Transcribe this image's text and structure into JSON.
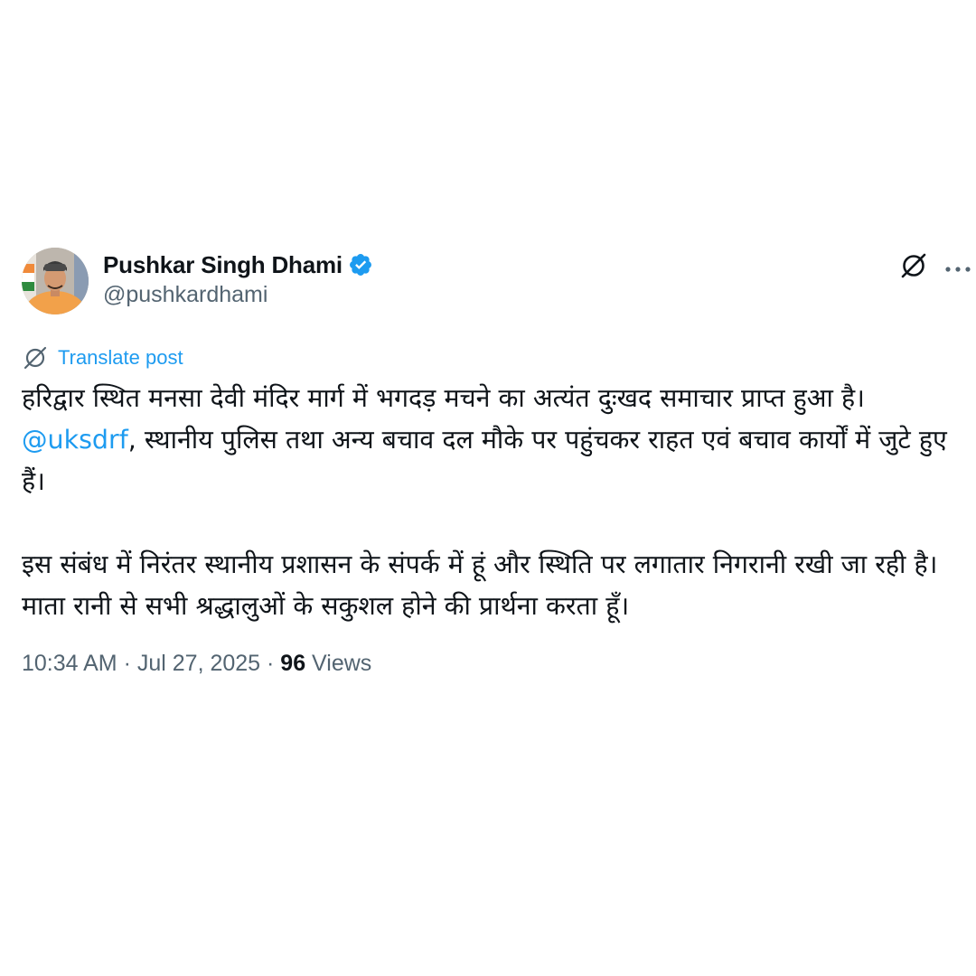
{
  "author": {
    "name": "Pushkar Singh Dhami",
    "handle": "@pushkardhami",
    "verified": true,
    "verified_color": "#1d9bf0"
  },
  "actions": {
    "grok_icon": "grok-icon",
    "more_icon": "more-horizontal-icon"
  },
  "translate": {
    "label": "Translate post",
    "icon": "translate-icon"
  },
  "post": {
    "para1_line1": "हरिद्वार स्थित मनसा देवी मंदिर मार्ग में भगदड़ मचने का अत्यंत दुःखद समाचार प्राप्त हुआ है। ",
    "mention": "@uksdrf",
    "para1_rest": ", स्थानीय पुलिस तथा अन्य बचाव दल मौके पर पहुंचकर राहत एवं बचाव कार्यों में जुटे हुए हैं।",
    "para2": "इस संबंध में निरंतर स्थानीय प्रशासन के संपर्क में हूं और स्थिति पर लगातार निगरानी रखी जा रही है। माता रानी से सभी श्रद्धालुओं के सकुशल होने की प्रार्थना करता हूँ।"
  },
  "meta": {
    "time": "10:34 AM",
    "separator": " · ",
    "date": "Jul 27, 2025",
    "views_count": "96",
    "views_label": " Views"
  },
  "colors": {
    "text_primary": "#0f1419",
    "text_secondary": "#536471",
    "accent": "#1d9bf0"
  }
}
